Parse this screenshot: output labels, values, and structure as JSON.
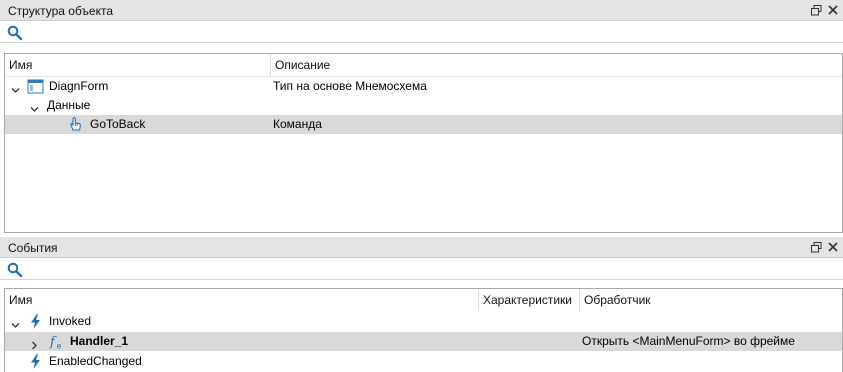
{
  "structure_panel": {
    "title": "Структура объекта",
    "columns": {
      "name": "Имя",
      "description": "Описание"
    },
    "rows": [
      {
        "name": "DiagnForm",
        "description": "Тип на основе Мнемосхема"
      },
      {
        "name": "Данные",
        "description": ""
      },
      {
        "name": "GoToBack",
        "description": "Команда"
      }
    ]
  },
  "events_panel": {
    "title": "События",
    "columns": {
      "name": "Имя",
      "characteristics": "Характеристики",
      "handler": "Обработчик"
    },
    "rows": [
      {
        "name": "Invoked",
        "characteristics": "",
        "handler": ""
      },
      {
        "name": "Handler_1",
        "characteristics": "",
        "handler": "Открыть <MainMenuForm> во фрейме"
      },
      {
        "name": "EnabledChanged",
        "characteristics": "",
        "handler": ""
      }
    ]
  },
  "colors": {
    "selected_row": "#d9d9d9",
    "header_bg": "#e4e4e4",
    "icon_blue": "#1f6fb5"
  }
}
